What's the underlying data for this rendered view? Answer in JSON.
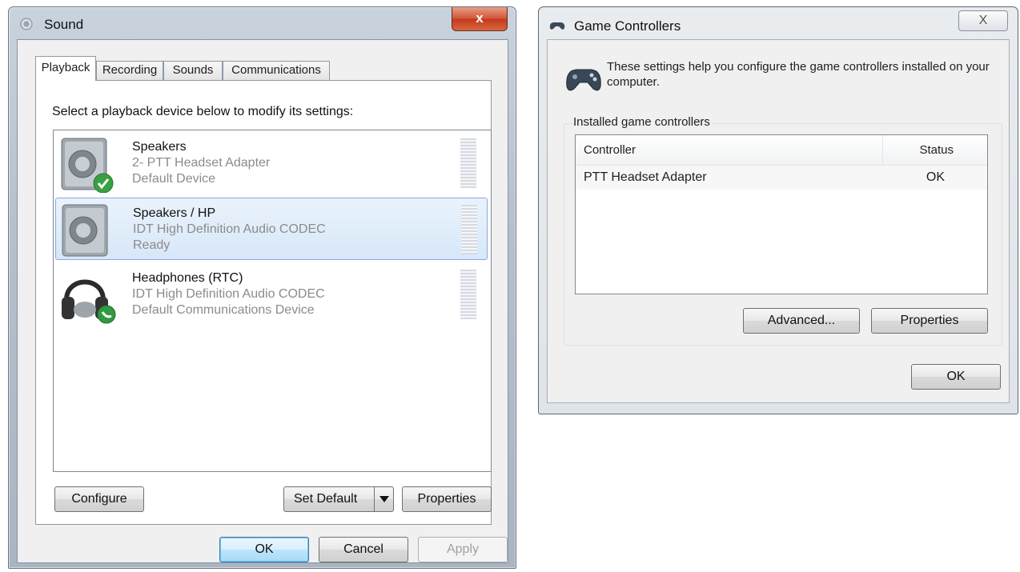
{
  "sound": {
    "title": "Sound",
    "close_label": "x",
    "tabs": [
      "Playback",
      "Recording",
      "Sounds",
      "Communications"
    ],
    "instruction": "Select a playback device below to modify its settings:",
    "devices": [
      {
        "name": "Speakers",
        "line2": "2- PTT Headset Adapter",
        "line3": "Default Device"
      },
      {
        "name": "Speakers / HP",
        "line2": "IDT High Definition Audio CODEC",
        "line3": "Ready"
      },
      {
        "name": "Headphones (RTC)",
        "line2": "IDT High Definition Audio CODEC",
        "line3": "Default Communications Device"
      }
    ],
    "buttons": {
      "configure": "Configure",
      "set_default": "Set Default",
      "properties": "Properties",
      "ok": "OK",
      "cancel": "Cancel",
      "apply": "Apply"
    }
  },
  "game_controllers": {
    "title": "Game Controllers",
    "close_label": "X",
    "info": "These settings help you configure the game controllers installed on your computer.",
    "group_label": "Installed game controllers",
    "columns": [
      "Controller",
      "Status"
    ],
    "rows": [
      {
        "controller": "PTT Headset Adapter",
        "status": "OK"
      }
    ],
    "buttons": {
      "advanced": "Advanced...",
      "properties": "Properties",
      "ok": "OK"
    }
  },
  "icons": {
    "sound_title": "speaker-icon",
    "gc_title": "gamepad-icon",
    "speaker_default": "speaker-default-check-icon",
    "speaker_hp": "speaker-icon",
    "headphones": "headphones-phone-icon"
  }
}
